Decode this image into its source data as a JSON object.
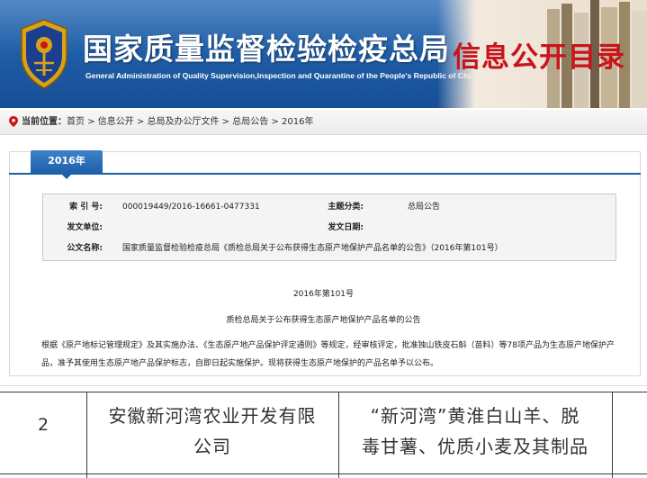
{
  "banner": {
    "title_cn": "国家质量监督检验检疫总局",
    "title_en": "General Administration of Quality Supervision,Inspection and Quarantine of the People's Republic of China",
    "section_title": "信息公开目录",
    "colors": {
      "banner_blue": "#1f5ea8",
      "section_red": "#c8141c"
    }
  },
  "breadcrumb": {
    "label": "当前位置：",
    "items": [
      "首页",
      "信息公开",
      "总局及办公厅文件",
      "总局公告",
      "2016年"
    ],
    "separator": " > "
  },
  "tab": {
    "label": "2016年"
  },
  "meta": {
    "index_label": "索 引 号:",
    "index_value": "000019449/2016-16661-0477331",
    "category_label": "主题分类:",
    "category_value": "总局公告",
    "issuer_label": "发文单位:",
    "issuer_value": "",
    "date_label": "发文日期:",
    "date_value": "",
    "doc_name_label": "公文名称:",
    "doc_name_value": "国家质量监督检验检疫总局《质检总局关于公布获得生态原产地保护产品名单的公告》（2016年第101号）"
  },
  "body": {
    "doc_number": "2016年第101号",
    "doc_title": "质检总局关于公布获得生态原产地保护产品名单的公告",
    "paragraph": "根据《原产地标记管理规定》及其实施办法、《生态原产地产品保护评定通则》等规定，经审核评定，批准独山铁皮石斛（苗料）等78项产品为生态原产地保护产品，准予其使用生态原产地产品保护标志，自即日起实施保护。现将获得生态原产地保护的产品名单予以公布。"
  },
  "zoom_row": {
    "index": "2",
    "company_line1": "安徽新河湾农业开发有限",
    "company_line2": "公司",
    "product_line1": "“新河湾”黄淮白山羊、脱",
    "product_line2": "毒甘薯、优质小麦及其制品"
  }
}
